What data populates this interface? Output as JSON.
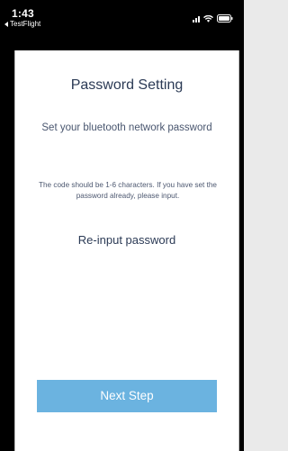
{
  "status_bar": {
    "time": "1:43",
    "back_app": "TestFlight"
  },
  "screen": {
    "title": "Password Setting",
    "subtitle": "Set your bluetooth network password",
    "note": "The code should be 1-6 characters. If you have set the password already, please input.",
    "reinput_label": "Re-input password",
    "next_button_label": "Next Step"
  },
  "colors": {
    "accent": "#6bb3e0",
    "title_text": "#2b3a55",
    "body_text": "#4d5870",
    "status_bar_bg": "#000000"
  }
}
